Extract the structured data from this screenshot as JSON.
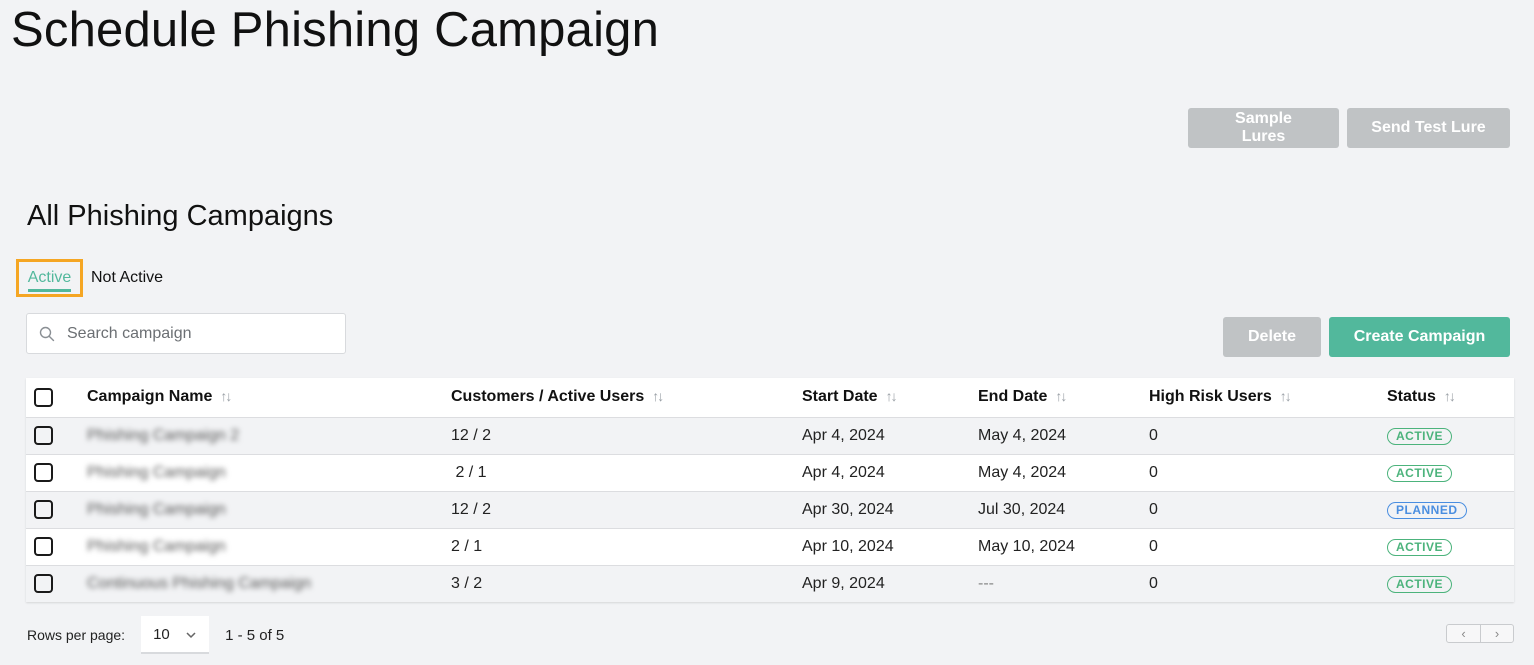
{
  "page": {
    "title": "Schedule Phishing Campaign"
  },
  "top_actions": {
    "sample_lures": "Sample Lures",
    "send_test_lure": "Send Test Lure"
  },
  "section": {
    "title": "All Phishing Campaigns"
  },
  "tabs": [
    {
      "label": "Active",
      "selected": true
    },
    {
      "label": "Not Active",
      "selected": false
    }
  ],
  "search": {
    "placeholder": "Search campaign",
    "value": ""
  },
  "table_actions": {
    "delete": "Delete",
    "create": "Create Campaign"
  },
  "table": {
    "columns": [
      "Campaign Name",
      "Customers / Active Users",
      "Start Date",
      "End Date",
      "High Risk Users",
      "Status"
    ],
    "sort_icon": "⇅",
    "rows": [
      {
        "name": "Phishing Campaign 2",
        "customers_users": "12 / 2",
        "start": "Apr 4, 2024",
        "end": "May 4, 2024",
        "high_risk": "0",
        "status": "ACTIVE"
      },
      {
        "name": "Phishing Campaign",
        "customers_users": " 2 / 1",
        "start": "Apr 4, 2024",
        "end": "May 4, 2024",
        "high_risk": "0",
        "status": "ACTIVE"
      },
      {
        "name": "Phishing Campaign",
        "customers_users": "12 / 2",
        "start": "Apr 30, 2024",
        "end": "Jul 30, 2024",
        "high_risk": "0",
        "status": "PLANNED"
      },
      {
        "name": "Phishing Campaign",
        "customers_users": "2 / 1",
        "start": "Apr 10, 2024",
        "end": "May 10, 2024",
        "high_risk": "0",
        "status": "ACTIVE"
      },
      {
        "name": "Continuous Phishing Campaign",
        "customers_users": "3 / 2",
        "start": "Apr 9, 2024",
        "end": "---",
        "high_risk": "0",
        "status": "ACTIVE"
      }
    ]
  },
  "pagination": {
    "rows_per_page_label": "Rows per page:",
    "rows_per_page_value": "10",
    "range": "1 - 5 of 5",
    "prev": "‹",
    "next": "›"
  },
  "colors": {
    "accent": "#52b89c",
    "disabled_button": "#c0c3c5",
    "highlight_outline": "#f5a623",
    "status_active": "#4cb37c",
    "status_planned": "#4a8ee0"
  }
}
